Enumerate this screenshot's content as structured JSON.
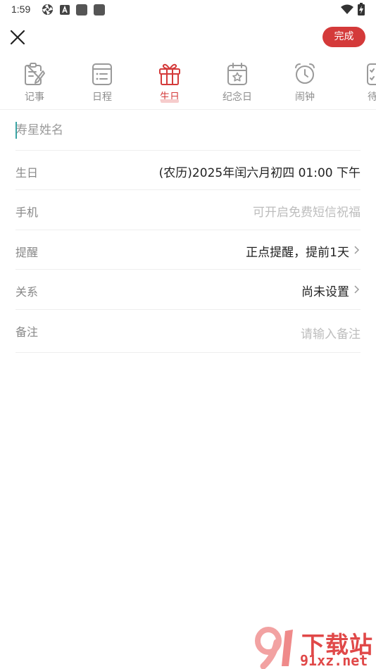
{
  "status_bar": {
    "time": "1:59",
    "icons": [
      "aperture-icon",
      "a-box-icon",
      "gray-square-icon",
      "gray-square-icon",
      "wifi-icon",
      "battery-charging-icon"
    ]
  },
  "header": {
    "close_icon": "close-icon",
    "done_label": "完成",
    "done_color": "#d43a3a"
  },
  "tabs": [
    {
      "label": "记事",
      "icon": "note-edit-icon",
      "active": false
    },
    {
      "label": "日程",
      "icon": "schedule-list-icon",
      "active": false
    },
    {
      "label": "生日",
      "icon": "gift-icon",
      "active": true
    },
    {
      "label": "纪念日",
      "icon": "calendar-star-icon",
      "active": false
    },
    {
      "label": "闹钟",
      "icon": "alarm-clock-icon",
      "active": false
    },
    {
      "label": "待",
      "icon": "todo-checklist-icon",
      "active": false
    }
  ],
  "form": {
    "name": {
      "value": "",
      "placeholder": "寿星姓名"
    },
    "birthday": {
      "label": "生日",
      "value": "(农历)2025年闰六月初四 01:00 下午"
    },
    "phone": {
      "label": "手机",
      "placeholder": "可开启免费短信祝福"
    },
    "reminder": {
      "label": "提醒",
      "value": "正点提醒，提前1天"
    },
    "relation": {
      "label": "关系",
      "value": "尚未设置"
    },
    "note": {
      "label": "备注",
      "placeholder": "请输入备注"
    }
  },
  "watermark": {
    "title": "下载站",
    "domain": "91xz.net"
  }
}
